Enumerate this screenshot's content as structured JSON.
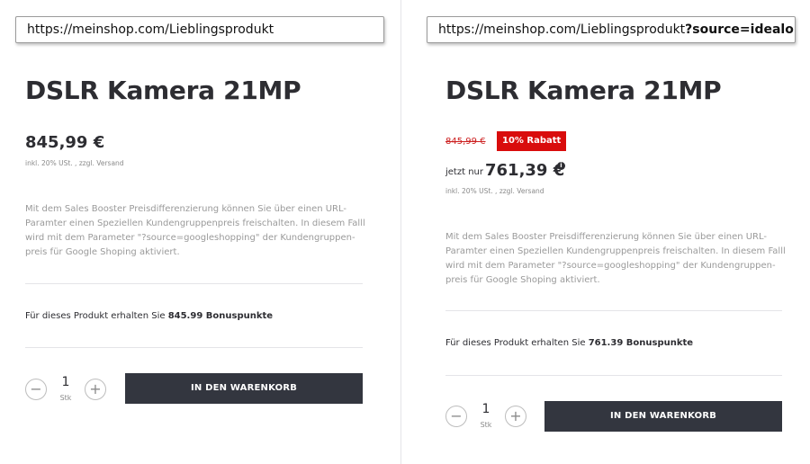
{
  "left": {
    "url": "https://meinshop.com/Lieblingsprodukt",
    "product_title": "DSLR Kamera 21MP",
    "price": "845,99 €",
    "tax_note": "inkl. 20% USt. , zzgl. Versand",
    "description": "Mit dem Sales Booster Preisdifferenzierung können Sie über einen URL-Paramter einen Speziellen Kundengruppenpreis freischalten. In diesem Falll wird mit dem Parameter \"?source=googleshopping\" der Kundengruppen-preis für Google Shoping aktiviert.",
    "description_lines": [
      "Mit dem Sales Booster Preisdifferenzierung können Sie über einen URL-",
      "Paramter einen Speziellen Kundengruppenpreis freischalten. In diesem Falll",
      "wird mit dem Parameter \"?source=googleshopping\" der Kundengruppen-",
      "preis für Google Shoping aktiviert."
    ],
    "bonus_prefix": "Für dieses Produkt erhalten Sie ",
    "bonus_points": "845.99 Bonuspunkte",
    "quantity": "1",
    "quantity_unit": "Stk",
    "minus": "−",
    "plus": "+",
    "cart_button": "IN DEN WARENKORB"
  },
  "right": {
    "url_base": "https://meinshop.com/Lieblingsprodukt",
    "url_param": "?source=idealo",
    "product_title": "DSLR Kamera 21MP",
    "old_price": "845,99 €",
    "discount_badge": "10% Rabatt",
    "now_label": "jetzt nur",
    "price": "761,39 €",
    "info_icon": "i",
    "tax_note": "inkl. 20% USt. , zzgl. Versand",
    "description_lines": [
      "Mit dem Sales Booster Preisdifferenzierung können Sie über einen URL-",
      "Paramter einen Speziellen Kundengruppenpreis freischalten. In diesem Falll",
      "wird mit dem Parameter \"?source=googleshopping\" der Kundengruppen-",
      "preis für Google Shoping aktiviert."
    ],
    "bonus_prefix": "Für dieses Produkt erhalten Sie ",
    "bonus_points": "761.39 Bonuspunkte",
    "quantity": "1",
    "quantity_unit": "Stk",
    "minus": "−",
    "plus": "+",
    "cart_button": "IN DEN WARENKORB"
  },
  "colors": {
    "button_bg": "#33363f",
    "badge_bg": "#d90c0c",
    "old_price": "#cc1f1f",
    "muted_text": "#9a9a9a"
  }
}
